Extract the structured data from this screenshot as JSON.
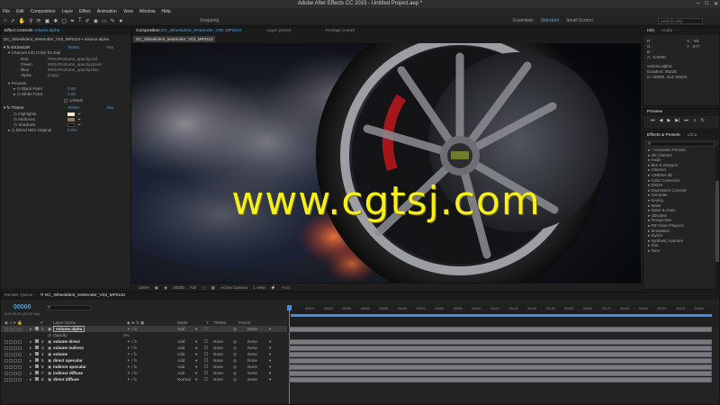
{
  "window": {
    "title": "Adobe After Effects CC 2015 - Untitled Project.aep *"
  },
  "menu": [
    "File",
    "Edit",
    "Composition",
    "Layer",
    "Effect",
    "Animation",
    "View",
    "Window",
    "Help"
  ],
  "toolbar": {
    "snapping": "Snapping"
  },
  "workspaces": {
    "essentials": "Essentials",
    "standard": "Standard",
    "small_screen": "Small Screen",
    "search_help": "Search Help"
  },
  "effect_controls": {
    "tab_label": "Effect Controls",
    "tab_layer": "volume.alpha",
    "breadcrumb": "DC_Wheelident_testrender_V03_MP0110 • volume.alpha",
    "extractor": {
      "name": "EXtractoR",
      "reset": "Reset",
      "about": "Abo"
    },
    "channel_info": "Channel Info (Click for Dial",
    "channels": [
      {
        "label": "Red",
        "value": "#0013#volume_opacity.red"
      },
      {
        "label": "Green",
        "value": "#0013#volume_opacity.green"
      },
      {
        "label": "Blue",
        "value": "#0013#volume_opacity.blue"
      },
      {
        "label": "Alpha",
        "value": "(copy)"
      }
    ],
    "process": "Process",
    "black_point": {
      "label": "Black Point",
      "value": "0.00"
    },
    "white_point": {
      "label": "White Point",
      "value": "1.00"
    },
    "unmult": "UnMult",
    "tritone": {
      "name": "Tritone",
      "reset": "Reset",
      "about": "Abo"
    },
    "highlights": "Highlights",
    "midtones": "Midtones",
    "shadows": "Shadows",
    "blend": {
      "label": "Blend With Original",
      "value": "0.0%"
    }
  },
  "composition": {
    "tab_label": "Composition",
    "comp_name": "DC_Wheelident_testrender_V03_MP0110",
    "layer_tab": "Layer (none)",
    "footage_tab": "Footage (none)",
    "sub_tab": "DC_Wheelident_testrender_V03_MP0110"
  },
  "viewer_bar": {
    "zoom": "100%",
    "timecode": "00000",
    "resolution": "Full",
    "camera": "Active Camera",
    "views": "1 View",
    "exposure": "+0.0"
  },
  "info": {
    "tab": "Info",
    "audio_tab": "Audio",
    "r": "R :",
    "g": "G :",
    "b": "B :",
    "a": "A : 0.0000",
    "x": "X : -55",
    "y": "Y : 677",
    "layer_name": "volume.alpha",
    "duration": "Duration: 00225",
    "in_out": "In: 00000, Out: 00224"
  },
  "preview": {
    "tab": "Preview"
  },
  "effects_presets": {
    "tab": "Effects & Presets",
    "libraries_tab": "Libra",
    "items": [
      "* Animation Presets",
      "3D Channel",
      "Audio",
      "Blur & Sharpen",
      "Channel",
      "CINEMA 4D",
      "Color Correction",
      "Distort",
      "Expression Controls",
      "Generate",
      "Keying",
      "Matte",
      "Noise & Grain",
      "Obsolete",
      "Perspective",
      "RE:Vision Plug-ins",
      "Simulation",
      "Stylize",
      "Synthetic Aperture",
      "Text",
      "Time"
    ]
  },
  "timeline": {
    "render_queue_tab": "Render Queue",
    "comp_tab": "DC_Wheelident_testrender_V03_MP0110",
    "timecode": "00000",
    "fps": "0:00:00:00 (25.00 fps)",
    "columns": {
      "layer_name": "Layer Name",
      "mode": "Mode",
      "t": "T",
      "trkmat": "TrkMat",
      "parent": "Parent"
    },
    "ruler": [
      "00010",
      "00020",
      "00030",
      "00040",
      "00050",
      "00060",
      "00070",
      "00080",
      "00090",
      "00100",
      "00110",
      "00120",
      "00130",
      "00140",
      "00150",
      "00160",
      "00170",
      "00180",
      "00190",
      "00200",
      "00210",
      "00220"
    ],
    "opacity_label": "Opacity",
    "opacity_value": "0%",
    "layers": [
      {
        "num": "1",
        "name": "volume.alpha",
        "mode": "Add",
        "trkmat": "",
        "parent": "None"
      },
      {
        "num": "2",
        "name": "volume direct",
        "mode": "Add",
        "trkmat": "None",
        "parent": "None"
      },
      {
        "num": "3",
        "name": "volume indirect",
        "mode": "Add",
        "trkmat": "None",
        "parent": "None"
      },
      {
        "num": "4",
        "name": "volume",
        "mode": "Add",
        "trkmat": "None",
        "parent": "None"
      },
      {
        "num": "5",
        "name": "direct specular",
        "mode": "Add",
        "trkmat": "None",
        "parent": "None"
      },
      {
        "num": "6",
        "name": "indirect specular",
        "mode": "Add",
        "trkmat": "None",
        "parent": "None"
      },
      {
        "num": "7",
        "name": "indirect diffuse",
        "mode": "Add",
        "trkmat": "None",
        "parent": "None"
      },
      {
        "num": "8",
        "name": "direct diffuse",
        "mode": "Normal",
        "trkmat": "None",
        "parent": "None"
      }
    ]
  },
  "watermark": "www.cgtsj.com",
  "colors": {
    "accent": "#4aa3e0",
    "watermark": "#f6ef1d",
    "playhead": "#3e8ee0"
  }
}
